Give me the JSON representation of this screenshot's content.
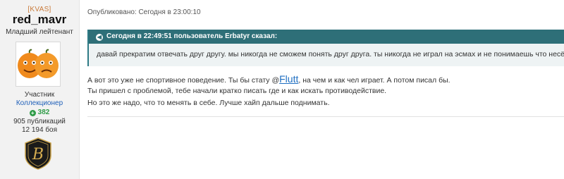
{
  "author": {
    "clan_tag": "[KVAS]",
    "username": "red_mavr",
    "rank": "Младший лейтенант",
    "avatar_icon": "pumpkin-faces-icon",
    "role": "Участник",
    "group": "Коллекционер",
    "reputation": "382",
    "posts": "905 публикаций",
    "battles": "12 194 боя",
    "badge_icon": "clan-emblem-icon",
    "badge_letter": "B"
  },
  "post": {
    "published": "Опубликовано: Сегодня в 23:00:10",
    "quote": {
      "header": "Сегодня в 22:49:51 пользователь Erbatyr сказал:",
      "text": "давай прекратим отвечать друг другу. мы никогда не сможем понять друг друга. ты никогда не играл на эсмах и не понимаешь что несёшь"
    },
    "line1_before": "А вот это уже не спортивное поведение. Ты бы стату @",
    "mention": "Flutt",
    "line1_after": ", на чем и как чел играет. А потом писал бы.",
    "line2": "Ты пришел с проблемой, тебе начали кратко писать где и как искать противодействие.",
    "line3": "Но это же надо, что то менять в себе. Лучше хайп дальше поднимать."
  },
  "colors": {
    "quote_header_bg": "#2e6f78",
    "quote_body_bg": "#eef3f4",
    "mention": "#1f6fc2",
    "clan_tag": "#c97a3a",
    "group": "#1f5fb8",
    "reputation": "#2e9b47"
  }
}
